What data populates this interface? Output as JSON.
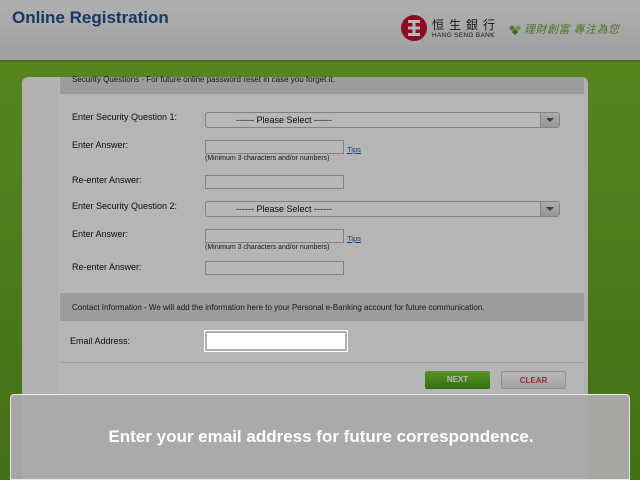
{
  "header": {
    "title": "Online Registration",
    "brand_cn": "恒生銀行",
    "brand_en": "HANG SENG BANK",
    "slogan": "理財創富 專注為您",
    "logo_icon": "hang-seng-logo",
    "slogan_icon": "diamond-leaves-icon",
    "brand_color": "#c8102e",
    "slogan_color": "#6ea33a"
  },
  "security": {
    "section_title": "Security Questions - For future online password reset in case you forget it.",
    "q1_label": "Enter Security Question 1:",
    "q1_selected": "------ Please Select ------",
    "answer1_label": "Enter Answer:",
    "answer1_value": "",
    "answer1_hint": "(Minimum 3 characters and/or numbers)",
    "tips_label": "Tips",
    "reenter1_label": "Re-enter Answer:",
    "reenter1_value": "",
    "q2_label": "Enter Security Question 2:",
    "q2_selected": "------ Please Select ------",
    "answer2_label": "Enter Answer:",
    "answer2_value": "",
    "answer2_hint": "(Minimum 3 characters and/or numbers)",
    "tips2_label": "Tips",
    "reenter2_label": "Re-enter Answer:",
    "reenter2_value": ""
  },
  "contact": {
    "section_title": "Contact Information - We will add the information here to your Personal e-Banking account for future communication.",
    "email_label": "Email Address:",
    "email_value": ""
  },
  "buttons": {
    "next": "NEXT",
    "clear": "CLEAR"
  },
  "tooltip": {
    "text": "Enter your email address for future correspondence."
  },
  "colors": {
    "accent_green": "#5e9b1f",
    "title_blue": "#1f4f8c",
    "link_blue": "#1a56b0",
    "clear_red": "#d04040"
  }
}
